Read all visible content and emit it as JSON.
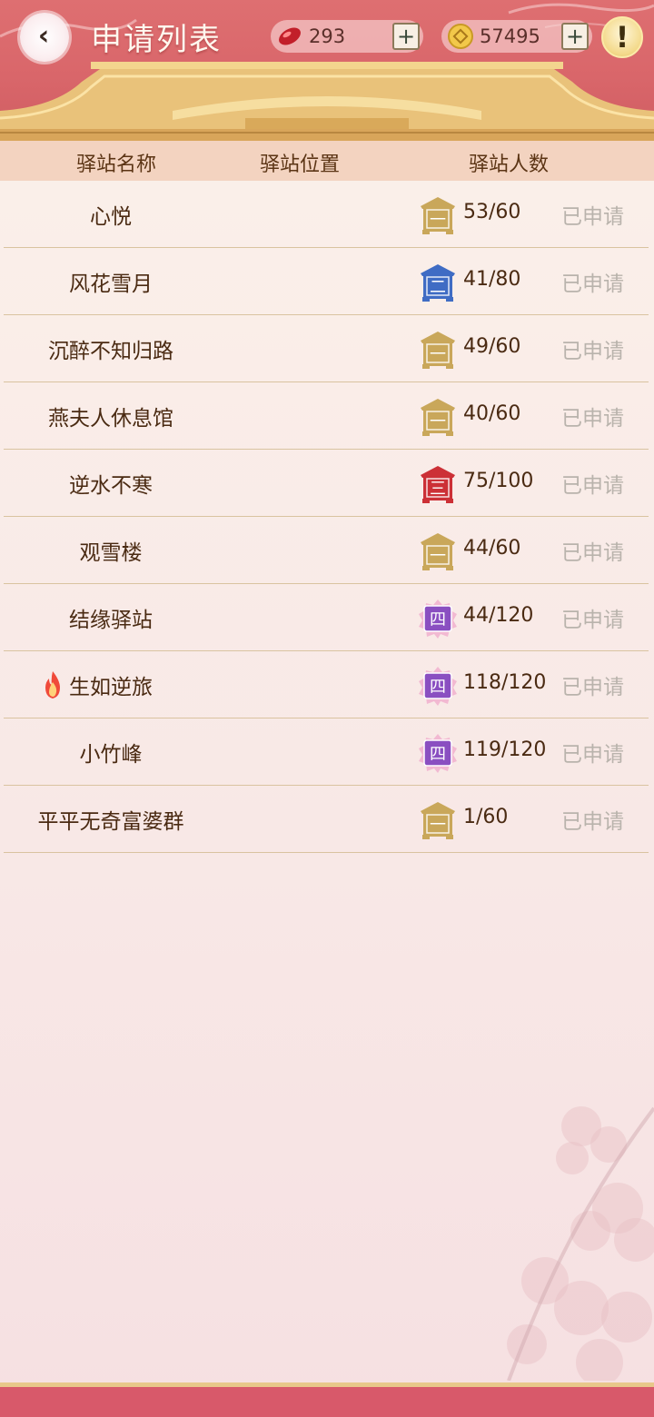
{
  "header": {
    "title": "申请列表",
    "back_icon": "chevron-left-icon",
    "gems": {
      "icon": "red-gem-icon",
      "amount": "293",
      "plus": "+"
    },
    "coins": {
      "icon": "gold-coin-icon",
      "amount": "57495",
      "plus": "+"
    },
    "alert_symbol": "!"
  },
  "columns": {
    "name": "驿站名称",
    "location": "驿站位置",
    "members": "驿站人数"
  },
  "colors": {
    "tier1": "#c9a75a",
    "tier2": "#3f6cc4",
    "tier3": "#cc3036",
    "tier4": "#8a4fc1",
    "header_red": "#de6f71",
    "status_gray": "#b9b3ac"
  },
  "rows": [
    {
      "name": "心悦",
      "tier": "一",
      "tier_level": 1,
      "count": "53/60",
      "status": "已申请",
      "hot": false
    },
    {
      "name": "风花雪月",
      "tier": "二",
      "tier_level": 2,
      "count": "41/80",
      "status": "已申请",
      "hot": false
    },
    {
      "name": "沉醉不知归路",
      "tier": "一",
      "tier_level": 1,
      "count": "49/60",
      "status": "已申请",
      "hot": false
    },
    {
      "name": "燕夫人休息馆",
      "tier": "一",
      "tier_level": 1,
      "count": "40/60",
      "status": "已申请",
      "hot": false
    },
    {
      "name": "逆水不寒",
      "tier": "三",
      "tier_level": 3,
      "count": "75/100",
      "status": "已申请",
      "hot": false
    },
    {
      "name": "观雪楼",
      "tier": "一",
      "tier_level": 1,
      "count": "44/60",
      "status": "已申请",
      "hot": false
    },
    {
      "name": "结缘驿站",
      "tier": "四",
      "tier_level": 4,
      "count": "44/120",
      "status": "已申请",
      "hot": false
    },
    {
      "name": "生如逆旅",
      "tier": "四",
      "tier_level": 4,
      "count": "118/120",
      "status": "已申请",
      "hot": true
    },
    {
      "name": "小竹峰",
      "tier": "四",
      "tier_level": 4,
      "count": "119/120",
      "status": "已申请",
      "hot": false
    },
    {
      "name": "平平无奇富婆群",
      "tier": "一",
      "tier_level": 1,
      "count": "1/60",
      "status": "已申请",
      "hot": false
    }
  ]
}
